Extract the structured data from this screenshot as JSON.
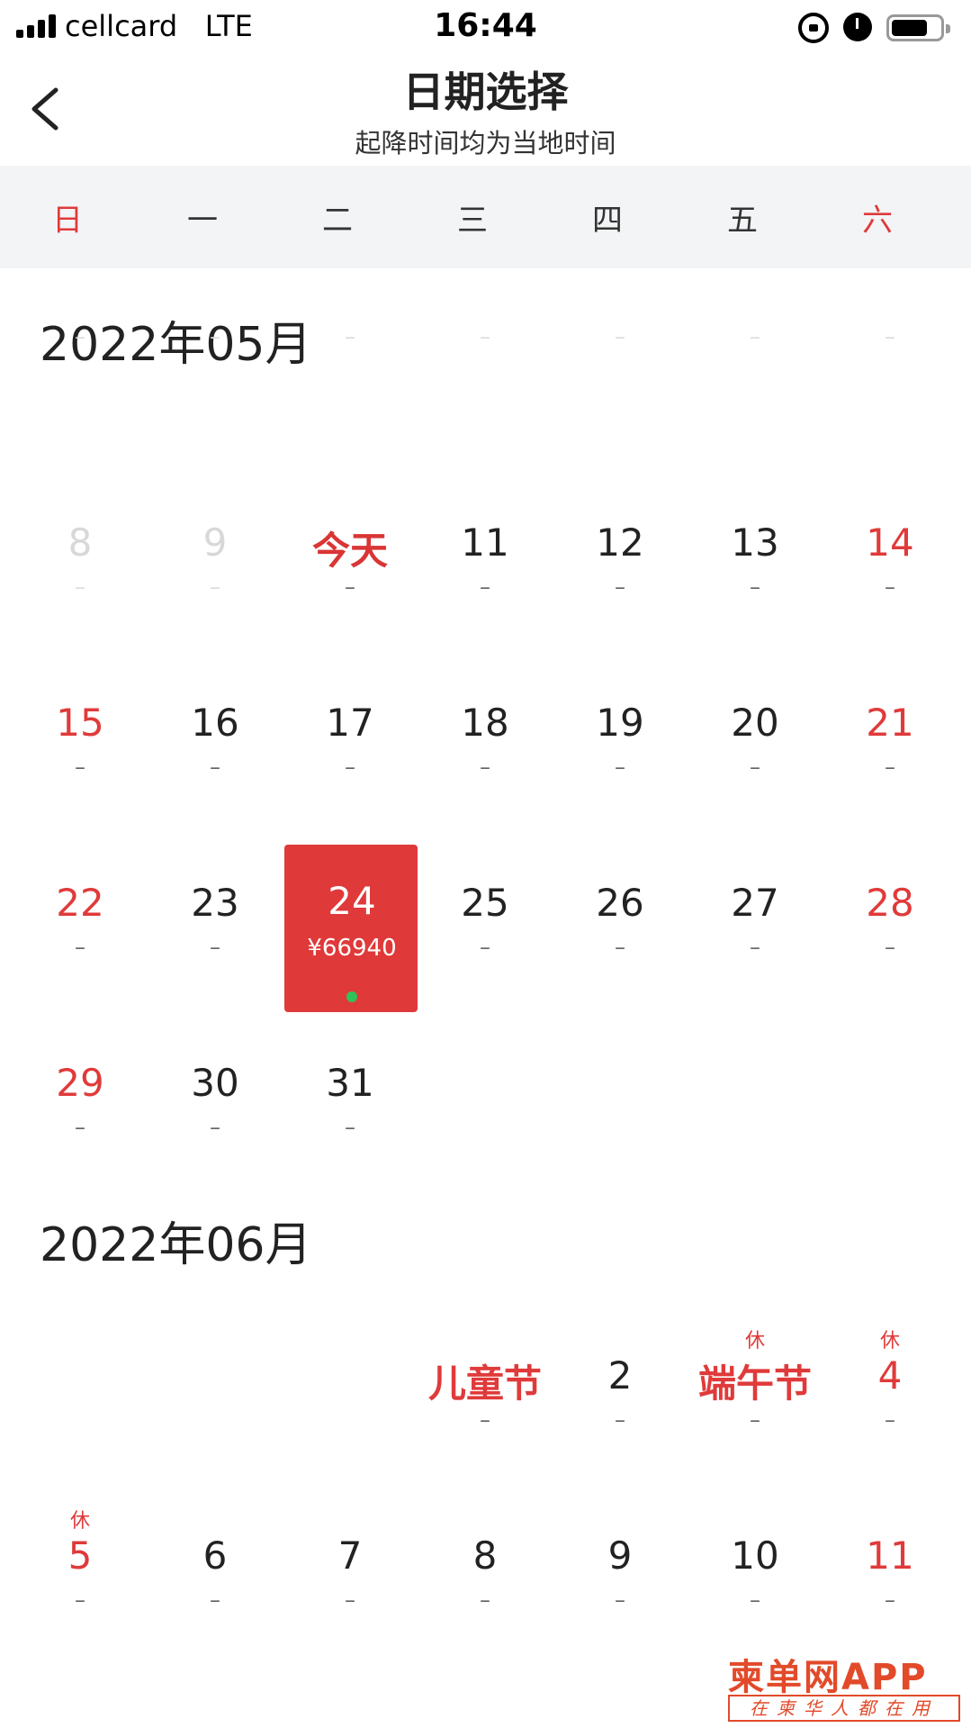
{
  "status_bar": {
    "carrier": "cellcard",
    "network": "LTE",
    "time": "16:44",
    "battery_level": 0.75
  },
  "nav": {
    "title": "日期选择",
    "subtitle": "起降时间均为当地时间"
  },
  "weekdays": [
    "日",
    "一",
    "二",
    "三",
    "四",
    "五",
    "六"
  ],
  "colors": {
    "accent_red": "#e0393a",
    "header_bg": "#f3f4f6",
    "price_dot": "#2fc35a"
  },
  "months": [
    {
      "title": "2022年05月",
      "rows": [
        [
          {
            "day": "",
            "sub": "–",
            "state": "empty"
          },
          {
            "day": "",
            "sub": "–",
            "state": "empty"
          },
          {
            "day": "",
            "sub": "–",
            "state": "empty"
          },
          {
            "day": "",
            "sub": "–",
            "state": "empty"
          },
          {
            "day": "",
            "sub": "–",
            "state": "empty"
          },
          {
            "day": "",
            "sub": "–",
            "state": "empty"
          },
          {
            "day": "",
            "sub": "–",
            "state": "empty"
          }
        ],
        [
          {
            "day": "8",
            "sub": "–",
            "state": "past"
          },
          {
            "day": "9",
            "sub": "–",
            "state": "past"
          },
          {
            "day": "今天",
            "sub": "–",
            "state": "today"
          },
          {
            "day": "11",
            "sub": "–"
          },
          {
            "day": "12",
            "sub": "–"
          },
          {
            "day": "13",
            "sub": "–"
          },
          {
            "day": "14",
            "sub": "–",
            "state": "red"
          }
        ],
        [
          {
            "day": "15",
            "sub": "–",
            "state": "red"
          },
          {
            "day": "16",
            "sub": "–"
          },
          {
            "day": "17",
            "sub": "–"
          },
          {
            "day": "18",
            "sub": "–"
          },
          {
            "day": "19",
            "sub": "–"
          },
          {
            "day": "20",
            "sub": "–"
          },
          {
            "day": "21",
            "sub": "–",
            "state": "red"
          }
        ],
        [
          {
            "day": "22",
            "sub": "–",
            "state": "red"
          },
          {
            "day": "23",
            "sub": "–"
          },
          {
            "day": "24",
            "sub": "¥66940",
            "state": "selected"
          },
          {
            "day": "25",
            "sub": "–"
          },
          {
            "day": "26",
            "sub": "–"
          },
          {
            "day": "27",
            "sub": "–"
          },
          {
            "day": "28",
            "sub": "–",
            "state": "red"
          }
        ],
        [
          {
            "day": "29",
            "sub": "–",
            "state": "red"
          },
          {
            "day": "30",
            "sub": "–"
          },
          {
            "day": "31",
            "sub": "–"
          }
        ]
      ]
    },
    {
      "title": "2022年06月",
      "rows": [
        [
          null,
          null,
          null,
          {
            "day": "儿童节",
            "sub": "–",
            "state": "festival"
          },
          {
            "day": "2",
            "sub": "–"
          },
          {
            "day": "端午节",
            "sub": "–",
            "state": "festival",
            "tag": "休"
          },
          {
            "day": "4",
            "sub": "–",
            "state": "red",
            "tag": "休"
          }
        ],
        [
          {
            "day": "5",
            "sub": "–",
            "state": "red",
            "tag": "休"
          },
          {
            "day": "6",
            "sub": "–"
          },
          {
            "day": "7",
            "sub": "–"
          },
          {
            "day": "8",
            "sub": "–"
          },
          {
            "day": "9",
            "sub": "–"
          },
          {
            "day": "10",
            "sub": "–"
          },
          {
            "day": "11",
            "sub": "–",
            "state": "red"
          }
        ]
      ]
    }
  ],
  "watermark": {
    "logo": "柬单网APP",
    "tagline": "在柬华人都在用"
  }
}
